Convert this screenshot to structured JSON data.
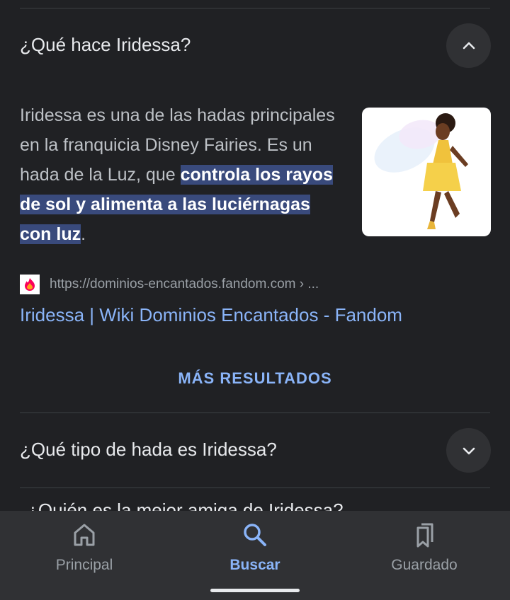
{
  "faq": [
    {
      "question": "¿Qué hace Iridessa?",
      "expanded": true,
      "answer_plain": "Iridessa es una de las hadas principales en la franquicia Disney Fairies. Es un hada de la Luz, que ",
      "answer_highlight": "controla los rayos de sol y alimenta a las luciérnagas con luz",
      "answer_end": ".",
      "source_url": "https://dominios-encantados.fandom.com › ...",
      "result_title": "Iridessa | Wiki Dominios Encantados - Fandom"
    },
    {
      "question": "¿Qué tipo de hada es Iridessa?",
      "expanded": false
    },
    {
      "question": "¿Quién es la mejor amiga de Iridessa?",
      "expanded": false
    }
  ],
  "more_results_label": "MÁS RESULTADOS",
  "bottom_nav": [
    {
      "label": "Principal",
      "icon": "home-icon",
      "active": false
    },
    {
      "label": "Buscar",
      "icon": "search-icon",
      "active": true
    },
    {
      "label": "Guardado",
      "icon": "bookmarks-icon",
      "active": false
    }
  ],
  "colors": {
    "background": "#202124",
    "accent": "#8ab4f8",
    "highlight": "#394a7c",
    "nav_bg": "#303134"
  }
}
